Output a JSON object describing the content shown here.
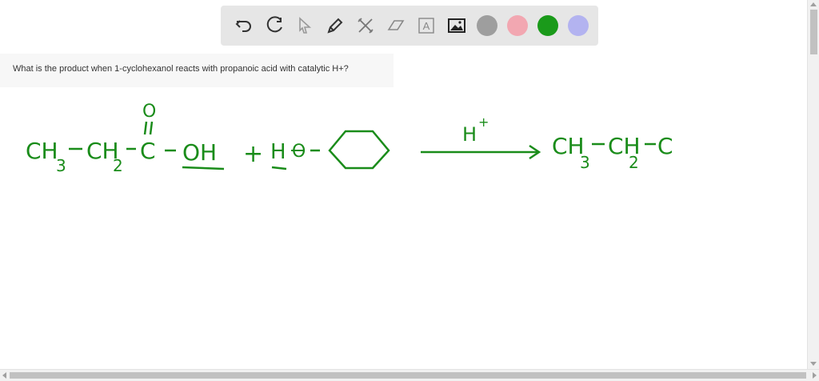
{
  "toolbar": {
    "tools": [
      {
        "name": "undo-icon"
      },
      {
        "name": "redo-icon"
      },
      {
        "name": "select-cursor-icon"
      },
      {
        "name": "pen-icon"
      },
      {
        "name": "tools-icon"
      },
      {
        "name": "eraser-icon"
      },
      {
        "name": "text-icon",
        "glyph": "A"
      },
      {
        "name": "image-icon"
      }
    ],
    "colors": [
      "#9e9e9e",
      "#f2a7b1",
      "#1a9a1a",
      "#b3b3f0"
    ],
    "selected_color": "#1a9a1a"
  },
  "question": {
    "text": "What is the product when 1-cyclohexanol reacts with propanoic acid with catalytic H+?"
  },
  "drawing": {
    "ink_color": "#1a8c1a",
    "reactant1": {
      "ch3": "CH",
      "ch3_sub": "3",
      "ch2": "CH",
      "ch2_sub": "2",
      "c": "C",
      "o_top": "O",
      "oh": "OH"
    },
    "plus": "+",
    "reactant2": {
      "h": "H",
      "o": "O"
    },
    "arrow_label": "H",
    "arrow_label_sup": "+",
    "product": {
      "ch3": "CH",
      "ch3_sub": "3",
      "ch2": "CH",
      "ch2_sub": "2",
      "c": "C"
    }
  }
}
